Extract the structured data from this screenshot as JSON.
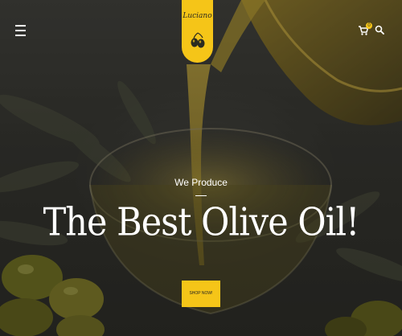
{
  "header": {
    "logo_text": "Luciano",
    "cart_count": "0"
  },
  "hero": {
    "pretitle": "We Produce",
    "headline": "The Best Olive Oil!",
    "cta_label": "SHOP NOW!"
  },
  "colors": {
    "accent": "#f5c518",
    "text": "#ffffff"
  },
  "icons": {
    "menu": "hamburger-menu-icon",
    "cart": "shopping-cart-icon",
    "search": "search-icon",
    "logo_mark": "olive-icon"
  }
}
